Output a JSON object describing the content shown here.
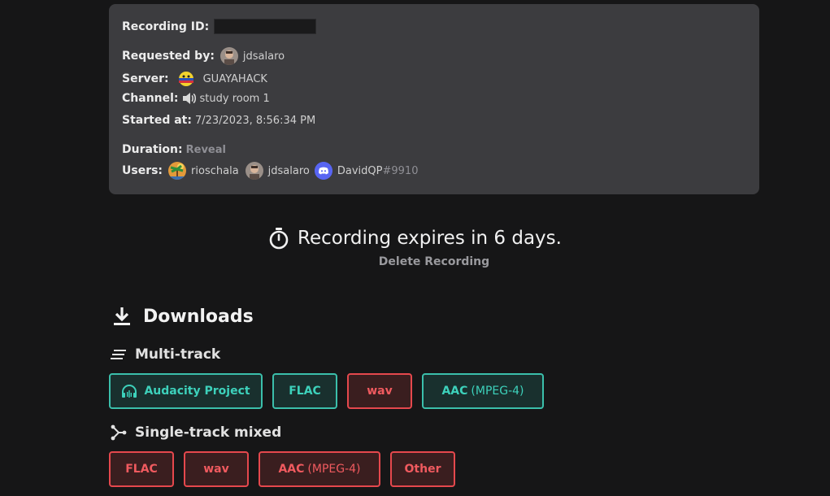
{
  "info": {
    "recording_id_label": "Recording ID:",
    "requested_by_label": "Requested by:",
    "requested_by_user": "jdsalaro",
    "server_label": "Server:",
    "server_name": "GUAYAHACK",
    "channel_label": "Channel:",
    "channel_name": "study room 1",
    "started_label": "Started at:",
    "started_value": "7/23/2023, 8:56:34 PM",
    "duration_label": "Duration:",
    "duration_reveal": "Reveal",
    "users_label": "Users:",
    "users": [
      {
        "name": "rioschala",
        "discriminator": "",
        "icon": "palm-avatar-icon"
      },
      {
        "name": "jdsalaro",
        "discriminator": "",
        "icon": "photo-avatar-icon"
      },
      {
        "name": "DavidQP",
        "discriminator": "#9910",
        "icon": "discord-avatar-icon"
      }
    ]
  },
  "expiry": {
    "text": "Recording expires in 6 days.",
    "delete_label": "Delete Recording",
    "icon": "stopwatch-icon"
  },
  "downloads": {
    "title": "Downloads",
    "multitrack": {
      "title": "Multi-track",
      "buttons": [
        {
          "label": "Audacity Project",
          "sub": "",
          "variant": "teal",
          "icon": "headphones-icon"
        },
        {
          "label": "FLAC",
          "sub": "",
          "variant": "teal"
        },
        {
          "label": "wav",
          "sub": "",
          "variant": "red"
        },
        {
          "label": "AAC",
          "sub": "(MPEG-4)",
          "variant": "teal"
        }
      ]
    },
    "singletrack": {
      "title": "Single-track mixed",
      "buttons": [
        {
          "label": "FLAC",
          "sub": "",
          "variant": "red"
        },
        {
          "label": "wav",
          "sub": "",
          "variant": "red"
        },
        {
          "label": "AAC",
          "sub": "(MPEG-4)",
          "variant": "red"
        },
        {
          "label": "Other",
          "sub": "",
          "variant": "red"
        }
      ]
    }
  },
  "colors": {
    "background": "#161617",
    "card": "#3c3c3f",
    "teal": "#3dd1bb",
    "red": "#f05a5f",
    "discord": "#5865f2"
  }
}
